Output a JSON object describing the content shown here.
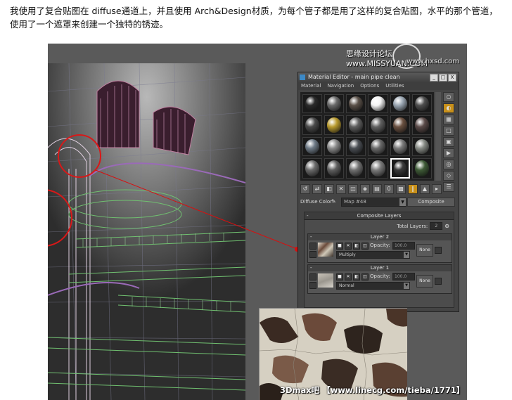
{
  "caption": "我使用了复合贴图在 diffuse通道上，并且使用 Arch&Design材质，为每个管子都是用了这样的复合贴图，水平的那个管道，使用了一个遮罩来创建一个独特的锈迹。",
  "watermark_top": "思缘设计论坛 www.MISSYUAN.COM",
  "watermark_top2": "www.hxsd.com",
  "watermark_bottom": "3Dmax吧 【www.linecg.com/tieba/1771】",
  "material_editor": {
    "title": "Material Editor - main pipe clean",
    "window_buttons": [
      "_",
      "□",
      "X"
    ],
    "menu": [
      "Material",
      "Navigation",
      "Options",
      "Utilities"
    ],
    "slot_colors": [
      [
        "#2a2a2a",
        "#6a6a6a",
        "#5a5048",
        "#f4f4f4",
        "#9aa6b2",
        "#4e4e4e"
      ],
      [
        "#4a4a4a",
        "#b89a2e",
        "#5e5e5e",
        "#606060",
        "#6a5040",
        "#5a4a48"
      ],
      [
        "#6e7a86",
        "#8a8a8a",
        "#4a4e54",
        "#6a6a6a",
        "#7a7a7a",
        "#868a84"
      ],
      [
        "#6a6a6a",
        "#5e5e5e",
        "#707070",
        "#7a7a7a",
        "#3a3a3a",
        "#3e5a36"
      ]
    ],
    "active_slot": [
      3,
      4
    ],
    "side_icons": [
      "sample-type-icon",
      "backlight-icon",
      "background-icon",
      "uv-tiling-icon",
      "video-check-icon",
      "make-preview-icon",
      "options-icon",
      "select-by-material-icon",
      "material-navigator-icon"
    ],
    "toolbar_icons": [
      "get-material-icon",
      "put-to-scene-icon",
      "assign-material-icon",
      "reset-icon",
      "copy-material-icon",
      "make-unique-icon",
      "put-to-library-icon",
      "material-id-icon",
      "show-map-icon",
      "show-end-result-icon",
      "go-to-parent-icon",
      "go-forward-icon"
    ],
    "diffuse_label": "Diffuse Color:",
    "map_name": "Map #48",
    "map_type": "Composite",
    "composite_layers_title": "Composite Layers",
    "total_layers_label": "Total Layers:",
    "total_layers_value": "2",
    "layers": [
      {
        "title": "Layer 2",
        "opacity_label": "Opacity:",
        "opacity_value": "100.0",
        "blend_mode": "Multiply",
        "mask": "None"
      },
      {
        "title": "Layer 1",
        "opacity_label": "Opacity:",
        "opacity_value": "100.0",
        "blend_mode": "Normal",
        "mask": "None"
      }
    ]
  },
  "colors": {
    "callout_red": "#d80f0f",
    "active_toolbar": "#c8901a"
  }
}
